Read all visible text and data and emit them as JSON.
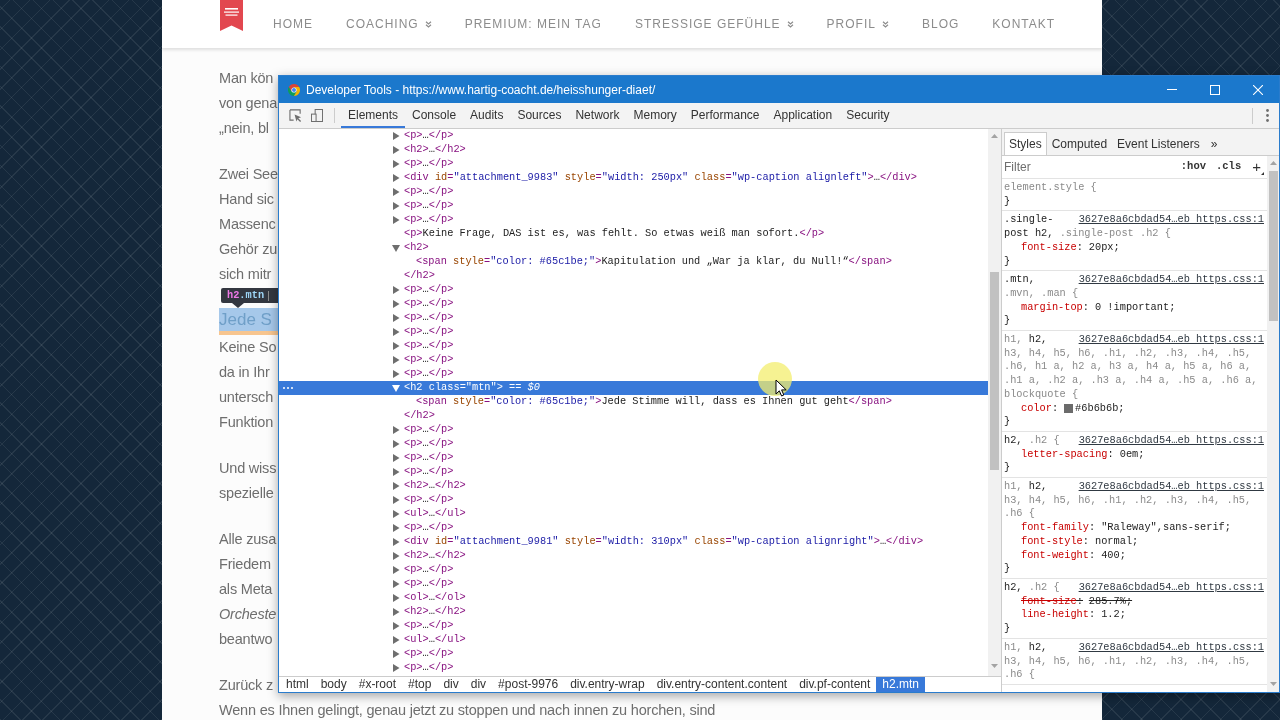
{
  "nav": [
    {
      "label": "HOME",
      "dropdown": false
    },
    {
      "label": "COACHING",
      "dropdown": true
    },
    {
      "label": "PREMIUM: MEIN TAG",
      "dropdown": false
    },
    {
      "label": "STRESSIGE GEFÜHLE",
      "dropdown": true
    },
    {
      "label": "PROFIL",
      "dropdown": true
    },
    {
      "label": "BLOG",
      "dropdown": false
    },
    {
      "label": "KONTAKT",
      "dropdown": false
    }
  ],
  "article": [
    {
      "kind": "paragraph",
      "lines": [
        {
          "text": "Man kön",
          "italic": false
        },
        {
          "text": "von gena",
          "italic": false
        },
        {
          "text": "„nein, bl",
          "italic": false
        }
      ]
    },
    {
      "kind": "paragraph",
      "lines": [
        {
          "text": "Zwei See",
          "italic": false
        },
        {
          "text": "Hand sic",
          "italic": false
        },
        {
          "text": "Massenc",
          "italic": false
        },
        {
          "text": "Gehör zu",
          "italic": false
        },
        {
          "text": "sich mitr",
          "italic": false
        }
      ]
    },
    {
      "kind": "heading",
      "text": "Jede S",
      "highlighted": true
    },
    {
      "kind": "paragraph",
      "lines": [
        {
          "text": "Keine So",
          "italic": false
        },
        {
          "text": "da in Ihr",
          "italic": false
        },
        {
          "text": "untersch",
          "italic": false
        },
        {
          "text": "Funktion",
          "italic": false
        }
      ]
    },
    {
      "kind": "paragraph",
      "lines": [
        {
          "text": "Und wiss",
          "italic": false
        },
        {
          "text": "spezielle",
          "italic": false
        }
      ]
    },
    {
      "kind": "paragraph",
      "lines": [
        {
          "text": "Alle zusa",
          "italic": false
        },
        {
          "text": "Friedem",
          "italic": false
        },
        {
          "text": "als Meta",
          "italic": false
        },
        {
          "text": "Orcheste",
          "italic": true
        },
        {
          "text": "beantwo",
          "italic": false
        }
      ]
    },
    {
      "kind": "paragraph",
      "lines": [
        {
          "text": "Zurück z",
          "italic": false
        },
        {
          "text": "Wenn es Ihnen gelingt, genau jetzt zu stoppen und nach innen zu horchen, sind",
          "italic": false
        }
      ]
    }
  ],
  "inspect_tooltip": {
    "selector": "h2.mtn"
  },
  "devtools": {
    "title": "Developer Tools - https://www.hartig-coacht.de/heisshunger-diaet/",
    "tabs": [
      {
        "label": "Elements",
        "selected": true
      },
      {
        "label": "Console",
        "selected": false
      },
      {
        "label": "Audits",
        "selected": false
      },
      {
        "label": "Sources",
        "selected": false
      },
      {
        "label": "Network",
        "selected": false
      },
      {
        "label": "Memory",
        "selected": false
      },
      {
        "label": "Performance",
        "selected": false
      },
      {
        "label": "Application",
        "selected": false
      },
      {
        "label": "Security",
        "selected": false
      }
    ],
    "dom_tree": [
      {
        "kind": "node",
        "text": "<p>…</p>",
        "expanded": false,
        "selected": false
      },
      {
        "kind": "node",
        "text": "<h2>…</h2>",
        "expanded": false,
        "selected": false
      },
      {
        "kind": "node",
        "text": "<p>…</p>",
        "expanded": false,
        "selected": false
      },
      {
        "kind": "node",
        "text": "<div id=\"attachment_9983\" style=\"width: 250px\" class=\"wp-caption alignleft\">…</div>",
        "expanded": false,
        "selected": false
      },
      {
        "kind": "node",
        "text": "<p>…</p>",
        "expanded": false,
        "selected": false
      },
      {
        "kind": "node",
        "text": "<p>…</p>",
        "expanded": false,
        "selected": false
      },
      {
        "kind": "node",
        "text": "<p>…</p>",
        "expanded": false,
        "selected": false
      },
      {
        "kind": "inline",
        "text": "<p>Keine Frage, DAS ist es, was fehlt. So etwas weiß man sofort.</p>",
        "selected": false
      },
      {
        "kind": "node",
        "text": "<h2>",
        "expanded": true,
        "selected": false,
        "children": [
          {
            "kind": "inline",
            "text": "<span style=\"color: #65c1be;\">Kapitulation und „War ja klar, du Null!“</span>",
            "selected": false
          }
        ],
        "closing_tag": "</h2>"
      },
      {
        "kind": "node",
        "text": "<p>…</p>",
        "expanded": false,
        "selected": false
      },
      {
        "kind": "node",
        "text": "<p>…</p>",
        "expanded": false,
        "selected": false
      },
      {
        "kind": "node",
        "text": "<p>…</p>",
        "expanded": false,
        "selected": false
      },
      {
        "kind": "node",
        "text": "<p>…</p>",
        "expanded": false,
        "selected": false
      },
      {
        "kind": "node",
        "text": "<p>…</p>",
        "expanded": false,
        "selected": false
      },
      {
        "kind": "node",
        "text": "<p>…</p>",
        "expanded": false,
        "selected": false
      },
      {
        "kind": "node",
        "text": "<p>…</p>",
        "expanded": false,
        "selected": false
      },
      {
        "kind": "node",
        "text": "<h2 class=\"mtn\">",
        "expanded": true,
        "selected": true,
        "marker": "== $0",
        "children": [
          {
            "kind": "inline",
            "text": "<span style=\"color: #65c1be;\">Jede Stimme will, dass es Ihnen gut geht</span>",
            "selected": false
          }
        ],
        "closing_tag": "</h2>"
      },
      {
        "kind": "node",
        "text": "<p>…</p>",
        "expanded": false,
        "selected": false
      },
      {
        "kind": "node",
        "text": "<p>…</p>",
        "expanded": false,
        "selected": false
      },
      {
        "kind": "node",
        "text": "<p>…</p>",
        "expanded": false,
        "selected": false
      },
      {
        "kind": "node",
        "text": "<p>…</p>",
        "expanded": false,
        "selected": false
      },
      {
        "kind": "node",
        "text": "<h2>…</h2>",
        "expanded": false,
        "selected": false
      },
      {
        "kind": "node",
        "text": "<p>…</p>",
        "expanded": false,
        "selected": false
      },
      {
        "kind": "node",
        "text": "<ul>…</ul>",
        "expanded": false,
        "selected": false
      },
      {
        "kind": "node",
        "text": "<p>…</p>",
        "expanded": false,
        "selected": false
      },
      {
        "kind": "node",
        "text": "<div id=\"attachment_9981\" style=\"width: 310px\" class=\"wp-caption alignright\">…</div>",
        "expanded": false,
        "selected": false
      },
      {
        "kind": "node",
        "text": "<h2>…</h2>",
        "expanded": false,
        "selected": false
      },
      {
        "kind": "node",
        "text": "<p>…</p>",
        "expanded": false,
        "selected": false
      },
      {
        "kind": "node",
        "text": "<p>…</p>",
        "expanded": false,
        "selected": false
      },
      {
        "kind": "node",
        "text": "<ol>…</ol>",
        "expanded": false,
        "selected": false
      },
      {
        "kind": "node",
        "text": "<h2>…</h2>",
        "expanded": false,
        "selected": false
      },
      {
        "kind": "node",
        "text": "<p>…</p>",
        "expanded": false,
        "selected": false
      },
      {
        "kind": "node",
        "text": "<ul>…</ul>",
        "expanded": false,
        "selected": false
      },
      {
        "kind": "node",
        "text": "<p>…</p>",
        "expanded": false,
        "selected": false
      },
      {
        "kind": "node",
        "text": "<p>…</p>",
        "expanded": false,
        "selected": false
      }
    ],
    "breadcrumbs": [
      {
        "label": "html",
        "selected": false
      },
      {
        "label": "body",
        "selected": false
      },
      {
        "label": "#x-root",
        "selected": false
      },
      {
        "label": "#top",
        "selected": false
      },
      {
        "label": "div",
        "selected": false
      },
      {
        "label": "div",
        "selected": false
      },
      {
        "label": "#post-9976",
        "selected": false
      },
      {
        "label": "div.entry-wrap",
        "selected": false
      },
      {
        "label": "div.entry-content.content",
        "selected": false
      },
      {
        "label": "div.pf-content",
        "selected": false
      },
      {
        "label": "h2.mtn",
        "selected": true
      }
    ],
    "styles_pane": {
      "tabs": [
        {
          "label": "Styles",
          "selected": true
        },
        {
          "label": "Computed",
          "selected": false
        },
        {
          "label": "Event Listeners",
          "selected": false
        }
      ],
      "more_tabs": "»",
      "filter": {
        "placeholder": "Filter"
      },
      "buttons": [
        {
          "label": ":hov",
          "kind": "toggle"
        },
        {
          "label": ".cls",
          "kind": "toggle"
        },
        {
          "label": "+",
          "kind": "add"
        }
      ],
      "rules": [
        {
          "selector_lines": [
            {
              "parts": [
                {
                  "text": "element.style {",
                  "dimmed": true
                }
              ]
            }
          ],
          "close": "}"
        },
        {
          "source": "3627e8a6cbdad54…eb https.css:1",
          "selector_lines": [
            {
              "parts": [
                {
                  "text": ".single-",
                  "dimmed": false
                }
              ]
            },
            {
              "parts": [
                {
                  "text": "post h2, ",
                  "dimmed": false
                },
                {
                  "text": ".single-post .h2 {",
                  "dimmed": true
                }
              ]
            }
          ],
          "declarations": [
            {
              "text": "font-size: 20px;",
              "overridden": false
            }
          ],
          "close": "}"
        },
        {
          "source": "3627e8a6cbdad54…eb https.css:1",
          "selector_lines": [
            {
              "parts": [
                {
                  "text": ".mtn,",
                  "dimmed": false
                }
              ]
            },
            {
              "parts": [
                {
                  "text": ".mvn, .man {",
                  "dimmed": true
                }
              ]
            }
          ],
          "declarations": [
            {
              "text": "margin-top: 0 !important;",
              "overridden": false
            }
          ],
          "close": "}"
        },
        {
          "source": "3627e8a6cbdad54…eb https.css:1",
          "selector_lines": [
            {
              "parts": [
                {
                  "text": "h1, ",
                  "dimmed": true
                },
                {
                  "text": "h2,",
                  "dimmed": false
                }
              ]
            },
            {
              "parts": [
                {
                  "text": "h3, h4, h5, h6, .h1, .h2, .h3, .h4, .h5,",
                  "dimmed": true
                }
              ]
            },
            {
              "parts": [
                {
                  "text": ".h6, h1 a, h2 a, h3 a, h4 a, h5 a, h6 a,",
                  "dimmed": true
                }
              ]
            },
            {
              "parts": [
                {
                  "text": ".h1 a, .h2 a, .h3 a, .h4 a, .h5 a, .h6 a,",
                  "dimmed": true
                }
              ]
            },
            {
              "parts": [
                {
                  "text": "blockquote {",
                  "dimmed": true
                }
              ]
            }
          ],
          "declarations": [
            {
              "text": "color: #6b6b6b;",
              "overridden": false,
              "color": "#6b6b6b"
            }
          ],
          "close": "}"
        },
        {
          "source": "3627e8a6cbdad54…eb https.css:1",
          "selector_lines": [
            {
              "parts": [
                {
                  "text": "h2, ",
                  "dimmed": false
                },
                {
                  "text": ".h2 {",
                  "dimmed": true
                }
              ]
            }
          ],
          "declarations": [
            {
              "text": "letter-spacing: 0em;",
              "overridden": false
            }
          ],
          "close": "}"
        },
        {
          "source": "3627e8a6cbdad54…eb https.css:1",
          "selector_lines": [
            {
              "parts": [
                {
                  "text": "h1, ",
                  "dimmed": true
                },
                {
                  "text": "h2,",
                  "dimmed": false
                }
              ]
            },
            {
              "parts": [
                {
                  "text": "h3, h4, h5, h6, .h1, .h2, .h3, .h4, .h5,",
                  "dimmed": true
                }
              ]
            },
            {
              "parts": [
                {
                  "text": ".h6 {",
                  "dimmed": true
                }
              ]
            }
          ],
          "declarations": [
            {
              "text": "font-family: \"Raleway\",sans-serif;",
              "overridden": false
            },
            {
              "text": "font-style: normal;",
              "overridden": false
            },
            {
              "text": "font-weight: 400;",
              "overridden": false
            }
          ],
          "close": "}"
        },
        {
          "source": "3627e8a6cbdad54…eb https.css:1",
          "selector_lines": [
            {
              "parts": [
                {
                  "text": "h2, ",
                  "dimmed": false
                },
                {
                  "text": ".h2 {",
                  "dimmed": true
                }
              ]
            }
          ],
          "declarations": [
            {
              "text": "font-size: 285.7%;",
              "overridden": true
            },
            {
              "text": "line-height: 1.2;",
              "overridden": false
            }
          ],
          "close": "}"
        },
        {
          "source": "3627e8a6cbdad54…eb https.css:1",
          "selector_lines": [
            {
              "parts": [
                {
                  "text": "h1, ",
                  "dimmed": true
                },
                {
                  "text": "h2,",
                  "dimmed": false
                }
              ]
            },
            {
              "parts": [
                {
                  "text": "h3, h4, h5, h6, .h1, .h2, .h3, .h4, .h5,",
                  "dimmed": true
                }
              ]
            },
            {
              "parts": [
                {
                  "text": ".h6 {",
                  "dimmed": true
                }
              ]
            }
          ]
        }
      ]
    }
  }
}
